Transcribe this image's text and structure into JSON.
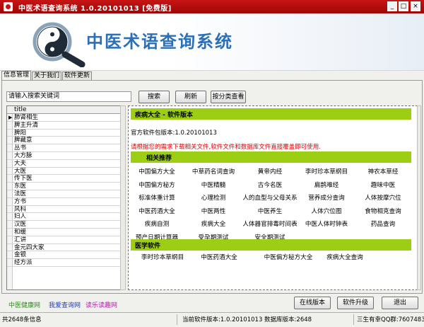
{
  "window": {
    "title": "中医术语查询系统 1.0.20101013 [免费版]",
    "controls": [
      "_",
      "□",
      "×"
    ]
  },
  "banner": {
    "app_name": "中医术语查询系统"
  },
  "tabs": [
    "信息管理",
    "关于我们",
    "软件更新"
  ],
  "search": {
    "value": "请输入搜索关键词",
    "buttons": {
      "search": "搜索",
      "refresh": "刷新",
      "category": "按分类查看"
    }
  },
  "list": {
    "column": "title",
    "items": [
      "肺肾相生",
      "脾主升清",
      "脾阳",
      "脾藏意",
      "丛书",
      "大方脉",
      "大夫",
      "大医",
      "传下医",
      "东医",
      "法医",
      "方书",
      "风科",
      "妇人",
      "汉医",
      "和缓",
      "汇讲",
      "金元四大家",
      "金银",
      "经方派"
    ]
  },
  "content": {
    "header": "疾病大全 - 软件版本",
    "version_line": "官方软件包版本:1.0.20101013",
    "notice": "请根据您的需求下载相关文件,软件文件和数据库文件直接覆盖即可使用.",
    "section1": "相关推荐",
    "links": [
      [
        "中国偏方大全",
        "中草药名词查询",
        "黄帝内经",
        "李时珍本草纲目",
        "神农本草经"
      ],
      [
        "中国偏方秘方",
        "中医精髓",
        "古今名医",
        "扁鹊难经",
        "趣味中医"
      ],
      [
        "标准体重计算",
        "心理检测",
        "人的血型与父母关系",
        "营养成分查询",
        "人体按摩穴位"
      ],
      [
        "中医药酒大全",
        "中医两性",
        "中医养生",
        "人体穴位图",
        "食物相克查询"
      ],
      [
        "疾病自测",
        "疾病大全",
        "人体器官排毒时间表",
        "中医人体时钟表",
        "药品查询"
      ],
      [
        "预产日期计算器",
        "受孕期测试",
        "安全期测试"
      ]
    ],
    "section2": "医学软件",
    "links2": [
      "李时珍本草纲目",
      "中医药酒大全",
      "中医偏方秘方大全",
      "疾病大全查询"
    ]
  },
  "footer": {
    "links": [
      "中医健康网",
      "我爱查询网",
      "读乐读趣网"
    ],
    "buttons": {
      "online": "在线版本",
      "upgrade": "软件升级",
      "exit": "退出"
    }
  },
  "status": {
    "count": "共2648条信息",
    "version": "当前软件版本:1.0.20101013 数据库版本:2648",
    "qq": "三生有幸QQ群:76074837"
  },
  "colors": {
    "titlebar": "#b40d0d",
    "accent_bar": "#9ccf13",
    "brand_blue": "#2b6fb7",
    "notice_red": "#e00000"
  }
}
